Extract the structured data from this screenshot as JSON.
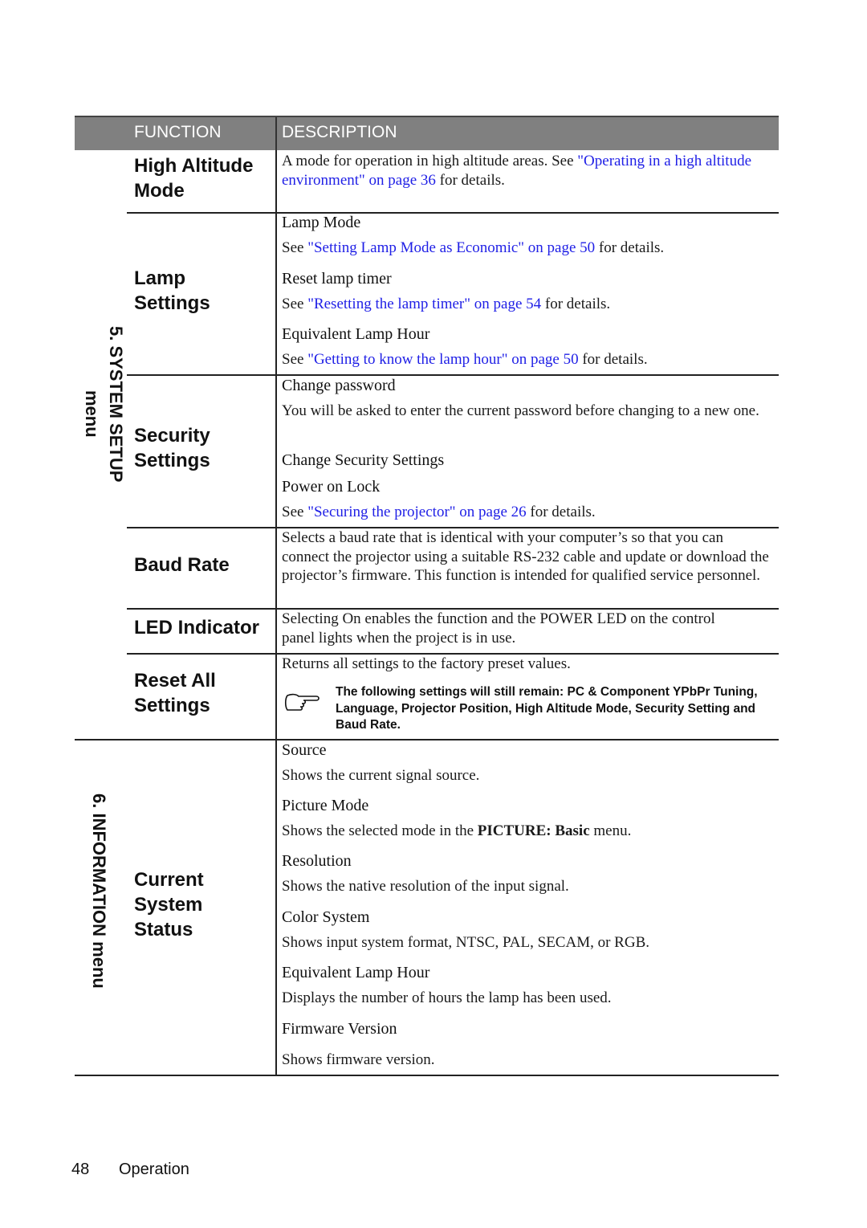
{
  "header": {
    "function_label": "FUNCTION",
    "description_label": "DESCRIPTION"
  },
  "sections": [
    {
      "label_line1": "5. SYSTEM SETUP",
      "label_line2": "menu"
    },
    {
      "label": "6. INFORMATION menu"
    }
  ],
  "rows": {
    "high_altitude": {
      "function_line1": "High Altitude",
      "function_line2": "Mode",
      "desc_text": "A mode for operation in high altitude areas. See ",
      "desc_link": "\"Operating in a high altitude environment\" on page 36",
      "desc_tail": " for details."
    },
    "lamp_settings": {
      "function_line1": "Lamp",
      "function_line2": "Settings",
      "items": [
        {
          "title": "Lamp Mode",
          "pre": "See ",
          "link": "\"Setting Lamp Mode as Economic\" on page 50",
          "post": " for details."
        },
        {
          "title": "Reset lamp timer",
          "pre": "See ",
          "link": "\"Resetting the lamp timer\" on page 54",
          "post": " for details."
        },
        {
          "title": "Equivalent Lamp Hour",
          "pre": "See ",
          "link": "\"Getting to know the lamp hour\" on page 50",
          "post": " for details."
        }
      ]
    },
    "security_settings": {
      "function_line1": "Security",
      "function_line2": "Settings",
      "change_password_title": "Change password",
      "change_password_desc": "You will be asked to enter the current password before changing to a new one.",
      "change_security_title": "Change Security Settings",
      "power_on_lock_title": "Power on Lock",
      "power_on_lock_pre": "See ",
      "power_on_lock_link": "\"Securing the projector\" on page 26",
      "power_on_lock_post": " for details."
    },
    "baud_rate": {
      "function": "Baud Rate",
      "desc": "Selects a baud rate that is identical with your computer’s so that you can connect the projector using a suitable RS-232 cable and update or download the projector’s firmware. This function is intended for qualified service personnel."
    },
    "led_indicator": {
      "function": "LED Indicator",
      "desc": "Selecting On enables the function and the POWER LED on the control panel lights when the project is in use."
    },
    "reset_all": {
      "function_line1": "Reset All",
      "function_line2": "Settings",
      "desc": "Returns all settings to the factory preset values.",
      "note": "The following settings will still remain: PC & Component YPbPr Tuning, Language, Projector Position, High Altitude Mode, Security Setting and Baud Rate."
    },
    "current_system_status": {
      "function_line1": "Current",
      "function_line2": "System",
      "function_line3": "Status",
      "items": [
        {
          "title": "Source",
          "desc": "Shows the current signal source."
        },
        {
          "title": "Picture Mode",
          "desc_pre": "Shows the selected mode in the ",
          "desc_bold": "PICTURE: Basic",
          "desc_post": " menu."
        },
        {
          "title": "Resolution",
          "desc": "Shows the native resolution of the input signal."
        },
        {
          "title": "Color System",
          "desc": "Shows input system format, NTSC, PAL, SECAM, or RGB."
        },
        {
          "title": "Equivalent Lamp Hour",
          "desc": "Displays the number of hours the lamp has been used."
        },
        {
          "title": "Firmware Version",
          "desc": "Shows firmware version."
        }
      ]
    }
  },
  "footer": {
    "page_number": "48",
    "section": "Operation"
  },
  "colors": {
    "header_bg": "#808080",
    "link": "#1f1fe6"
  }
}
